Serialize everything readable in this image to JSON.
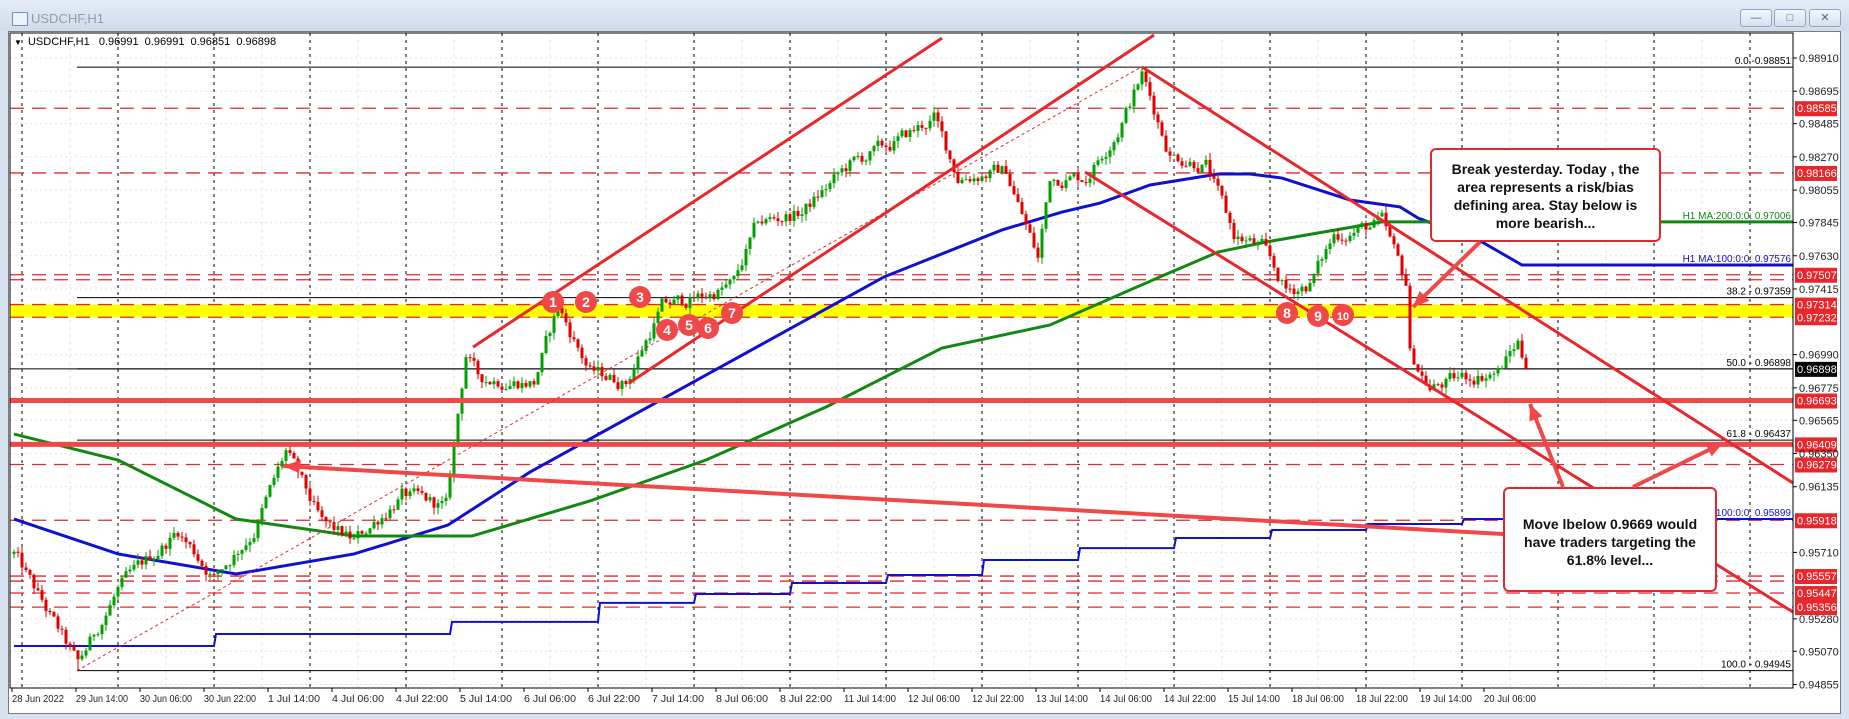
{
  "window": {
    "title": "USDCHF,H1",
    "minimize": "—",
    "maximize": "□",
    "close": "✕"
  },
  "info": {
    "symbol": "USDCHF,H1",
    "open": "0.96991",
    "high": "0.96991",
    "low": "0.96851",
    "close": "0.96898"
  },
  "chart_data": {
    "type": "candlestick",
    "title": "USDCHF,H1",
    "ylim": [
      0.9476,
      0.9918
    ],
    "price_path": [
      [
        0,
        0.957
      ],
      [
        16,
        0.9498
      ],
      [
        26,
        0.9547
      ],
      [
        41,
        0.9585
      ],
      [
        50,
        0.9555
      ],
      [
        60,
        0.9585
      ],
      [
        68,
        0.9636
      ],
      [
        77,
        0.9589
      ],
      [
        85,
        0.9578
      ],
      [
        97,
        0.9608
      ],
      [
        108,
        0.96
      ],
      [
        113,
        0.97
      ],
      [
        116,
        0.9684
      ],
      [
        130,
        0.9681
      ],
      [
        136,
        0.973
      ],
      [
        144,
        0.9688
      ],
      [
        153,
        0.9681
      ],
      [
        162,
        0.973
      ],
      [
        174,
        0.9738
      ],
      [
        180,
        0.9745
      ],
      [
        186,
        0.9784
      ],
      [
        197,
        0.9791
      ],
      [
        209,
        0.9822
      ],
      [
        221,
        0.9837
      ],
      [
        230,
        0.9852
      ],
      [
        236,
        0.9814
      ],
      [
        248,
        0.9818
      ],
      [
        256,
        0.9761
      ],
      [
        259,
        0.9814
      ],
      [
        268,
        0.9814
      ],
      [
        276,
        0.9845
      ],
      [
        282,
        0.988
      ],
      [
        289,
        0.9829
      ],
      [
        298,
        0.9822
      ],
      [
        305,
        0.9776
      ],
      [
        312,
        0.9768
      ],
      [
        318,
        0.974
      ],
      [
        324,
        0.9745
      ],
      [
        330,
        0.9776
      ],
      [
        342,
        0.9784
      ],
      [
        348,
        0.9745
      ],
      [
        349,
        0.97
      ],
      [
        354,
        0.9677
      ],
      [
        362,
        0.9684
      ],
      [
        371,
        0.9688
      ],
      [
        376,
        0.9707
      ],
      [
        378,
        0.96898
      ]
    ],
    "low_point": {
      "bar": 16,
      "price": 0.94945
    },
    "high_point": {
      "bar": 282,
      "price": 0.98851
    },
    "last_price": "0.96898",
    "y_tick_labels": [
      "0.98910",
      "0.98695",
      "0.98485",
      "0.98270",
      "0.98055",
      "0.97845",
      "0.97630",
      "0.97415",
      "0.96990",
      "0.96775",
      "0.96565",
      "0.96350",
      "0.96135",
      "0.95710",
      "0.95280",
      "0.95070",
      "0.94855"
    ],
    "x_tick_labels": [
      "28 Jun 2022",
      "29 Jun 14:00",
      "30 Jun 06:00",
      "30 Jun 22:00",
      "1 Jul 14:00",
      "4 Jul 06:00",
      "4 Jul 22:00",
      "5 Jul 14:00",
      "6 Jul 06:00",
      "6 Jul 22:00",
      "7 Jul 14:00",
      "8 Jul 06:00",
      "8 Jul 22:00",
      "11 Jul 14:00",
      "12 Jul 06:00",
      "12 Jul 22:00",
      "13 Jul 14:00",
      "14 Jul 06:00",
      "14 Jul 22:00",
      "15 Jul 14:00",
      "18 Jul 06:00",
      "18 Jul 22:00",
      "19 Jul 14:00",
      "20 Jul 06:00"
    ],
    "levels": [
      {
        "label": "0.98585",
        "price": 0.98585,
        "style": "dashed"
      },
      {
        "label": "0.98166",
        "price": 0.98166,
        "style": "dashed"
      },
      {
        "label": "0.97507",
        "price": 0.97507,
        "style": "double-dashed"
      },
      {
        "label": "0.97314",
        "price": 0.97314,
        "style": "dashed"
      },
      {
        "label": "0.97232",
        "price": 0.97232,
        "style": "dashed"
      },
      {
        "label": "0.96693",
        "price": 0.96693,
        "style": "thick"
      },
      {
        "label": "0.96409",
        "price": 0.96409,
        "style": "thick"
      },
      {
        "label": "0.96279",
        "price": 0.96279,
        "style": "dashed"
      },
      {
        "label": "0.95918",
        "price": 0.95918,
        "style": "dashed"
      },
      {
        "label": "0.95557",
        "price": 0.95557,
        "style": "double-dashed"
      },
      {
        "label": "0.95447",
        "price": 0.95447,
        "style": "dashed"
      },
      {
        "label": "0.95356",
        "price": 0.95356,
        "style": "dashed"
      }
    ],
    "zone": {
      "from": 0.97232,
      "to": 0.97314,
      "color": "#ffff00"
    },
    "fibonacci": [
      {
        "label": "0.0 -0.98851",
        "price": 0.98851
      },
      {
        "label": "38.2 - 0.97359",
        "price": 0.97359
      },
      {
        "label": "50.0 - 0.96898",
        "price": 0.96898
      },
      {
        "label": "61.8 - 0.96437",
        "price": 0.96437
      },
      {
        "label": "100.0 - 0.94945",
        "price": 0.94945
      }
    ],
    "series": [
      {
        "name": "H1 MA:100:0:0: 0.97576",
        "color": "#1010d0",
        "points": [
          [
            0,
            0.95926
          ],
          [
            26,
            0.957
          ],
          [
            55.5,
            0.9557
          ],
          [
            85,
            0.957
          ],
          [
            108.5,
            0.95887
          ],
          [
            129,
            0.9623
          ],
          [
            158.5,
            0.96651
          ],
          [
            188,
            0.97072
          ],
          [
            217.5,
            0.97493
          ],
          [
            247,
            0.97797
          ],
          [
            262,
            0.97913
          ],
          [
            271.5,
            0.97971
          ],
          [
            284,
            0.98088
          ],
          [
            301,
            0.98159
          ],
          [
            309,
            0.98159
          ],
          [
            317,
            0.98133
          ],
          [
            334,
            0.97991
          ],
          [
            346.5,
            0.97946
          ],
          [
            351,
            0.97874
          ],
          [
            367,
            0.97719
          ],
          [
            377,
            0.9757
          ]
        ]
      },
      {
        "name": "H1 MA:200:0:0: 0.97006",
        "color": "#118811",
        "points": [
          [
            0,
            0.96476
          ],
          [
            26,
            0.96308
          ],
          [
            55.5,
            0.95926
          ],
          [
            85,
            0.95816
          ],
          [
            114.5,
            0.95816
          ],
          [
            144,
            0.96043
          ],
          [
            173,
            0.96308
          ],
          [
            203,
            0.96651
          ],
          [
            232,
            0.97033
          ],
          [
            259,
            0.97182
          ],
          [
            286.5,
            0.97493
          ],
          [
            301,
            0.97654
          ],
          [
            313,
            0.97719
          ],
          [
            342,
            0.97849
          ]
        ]
      },
      {
        "name": "H1 MA:100:0:0: 0.95899",
        "color": "#1010d0",
        "steps": [
          [
            0,
            0.95104
          ],
          [
            50,
            0.95182
          ],
          [
            109,
            0.9526
          ],
          [
            146,
            0.95383
          ],
          [
            170,
            0.95441
          ],
          [
            194,
            0.95512
          ],
          [
            218,
            0.95564
          ],
          [
            242,
            0.95661
          ],
          [
            266,
            0.95738
          ],
          [
            290,
            0.95803
          ],
          [
            314,
            0.95855
          ],
          [
            338,
            0.95894
          ],
          [
            362,
            0.95926
          ]
        ]
      }
    ],
    "trendlines": [
      {
        "from": [
          114.75,
          0.97039
        ],
        "to": [
          232,
          0.99039
        ],
        "style": "solid"
      },
      {
        "from": [
          153.75,
          0.96806
        ],
        "to": [
          285,
          0.99059
        ],
        "style": "solid"
      },
      {
        "from": [
          15.75,
          0.94945
        ],
        "to": [
          281.75,
          0.98851
        ],
        "style": "dotted"
      },
      {
        "from": [
          282,
          0.98852
        ],
        "to": [
          444.75,
          0.96159
        ],
        "style": "solid"
      },
      {
        "from": [
          267.75,
          0.98172
        ],
        "to": [
          444.75,
          0.95324
        ],
        "style": "solid"
      },
      {
        "from": [
          67.25,
          0.96269
        ],
        "to": [
          372.25,
          0.95829
        ],
        "style": "arrow"
      }
    ],
    "markers": [
      "1",
      "2",
      "3",
      "4",
      "5",
      "6",
      "7",
      "8",
      "9",
      "10"
    ],
    "colors": {
      "bull": "#00a000",
      "bear": "#e00000",
      "level": "#e0282e",
      "marker": "#f04848"
    }
  },
  "callouts": {
    "top": {
      "lines": [
        "Break yesterday. Today , the",
        "area represents a risk/bias",
        "defining area. Stay below is",
        "more bearish..."
      ]
    },
    "bottom": {
      "lines": [
        "Move lbelow 0.9669 would",
        "have traders targeting the",
        "61.8% level..."
      ]
    }
  }
}
